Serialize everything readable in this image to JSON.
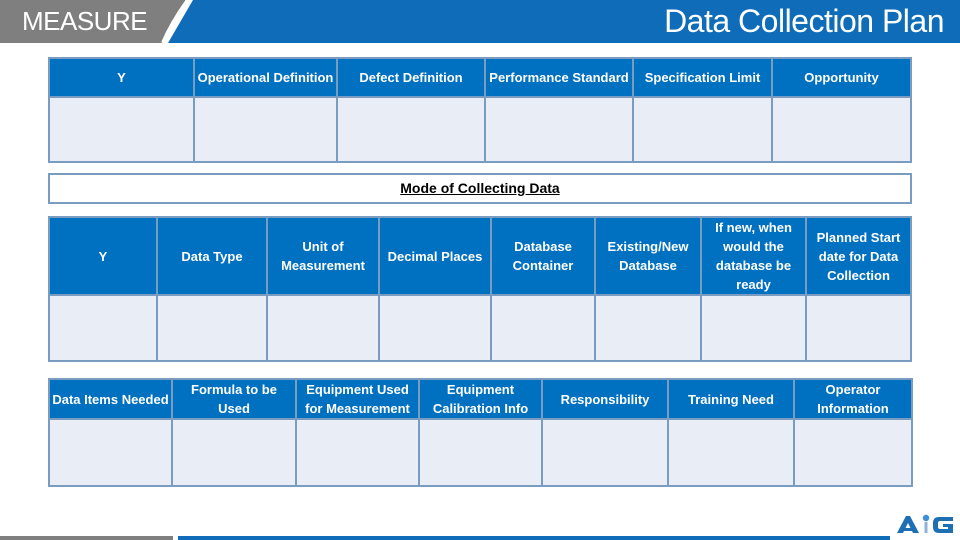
{
  "header": {
    "section": "MEASURE",
    "title": "Data Collection Plan",
    "colors": {
      "gray": "#7f7f7f",
      "blue": "#0f6cb8"
    }
  },
  "table1": {
    "headers": [
      "Y",
      "Operational Definition",
      "Defect Definition",
      "Performance Standard",
      "Specification Limit",
      "Opportunity"
    ],
    "rows": [
      [
        "",
        "",
        "",
        "",
        "",
        ""
      ]
    ]
  },
  "banner": {
    "label": "Mode of Collecting Data"
  },
  "table2": {
    "headers": [
      "Y",
      "Data Type",
      "Unit of Measurement",
      "Decimal Places",
      "Database Container",
      "Existing/New Database",
      "If new, when would the database be ready",
      "Planned Start date for Data Collection"
    ],
    "rows": [
      [
        "",
        "",
        "",
        "",
        "",
        "",
        "",
        ""
      ]
    ]
  },
  "table3": {
    "headers": [
      "Data Items Needed",
      "Formula to be Used",
      "Equipment Used for Measurement",
      "Equipment Calibration Info",
      "Responsibility",
      "Training Need",
      "Operator Information"
    ],
    "rows": [
      [
        "",
        "",
        "",
        "",
        "",
        "",
        ""
      ]
    ]
  },
  "logo": {
    "text": "AIG",
    "icon": "aig-logo-icon"
  },
  "colors": {
    "header_cell": "#0070c0",
    "body_cell": "#e8edf6",
    "border": "#7a9cc0"
  }
}
